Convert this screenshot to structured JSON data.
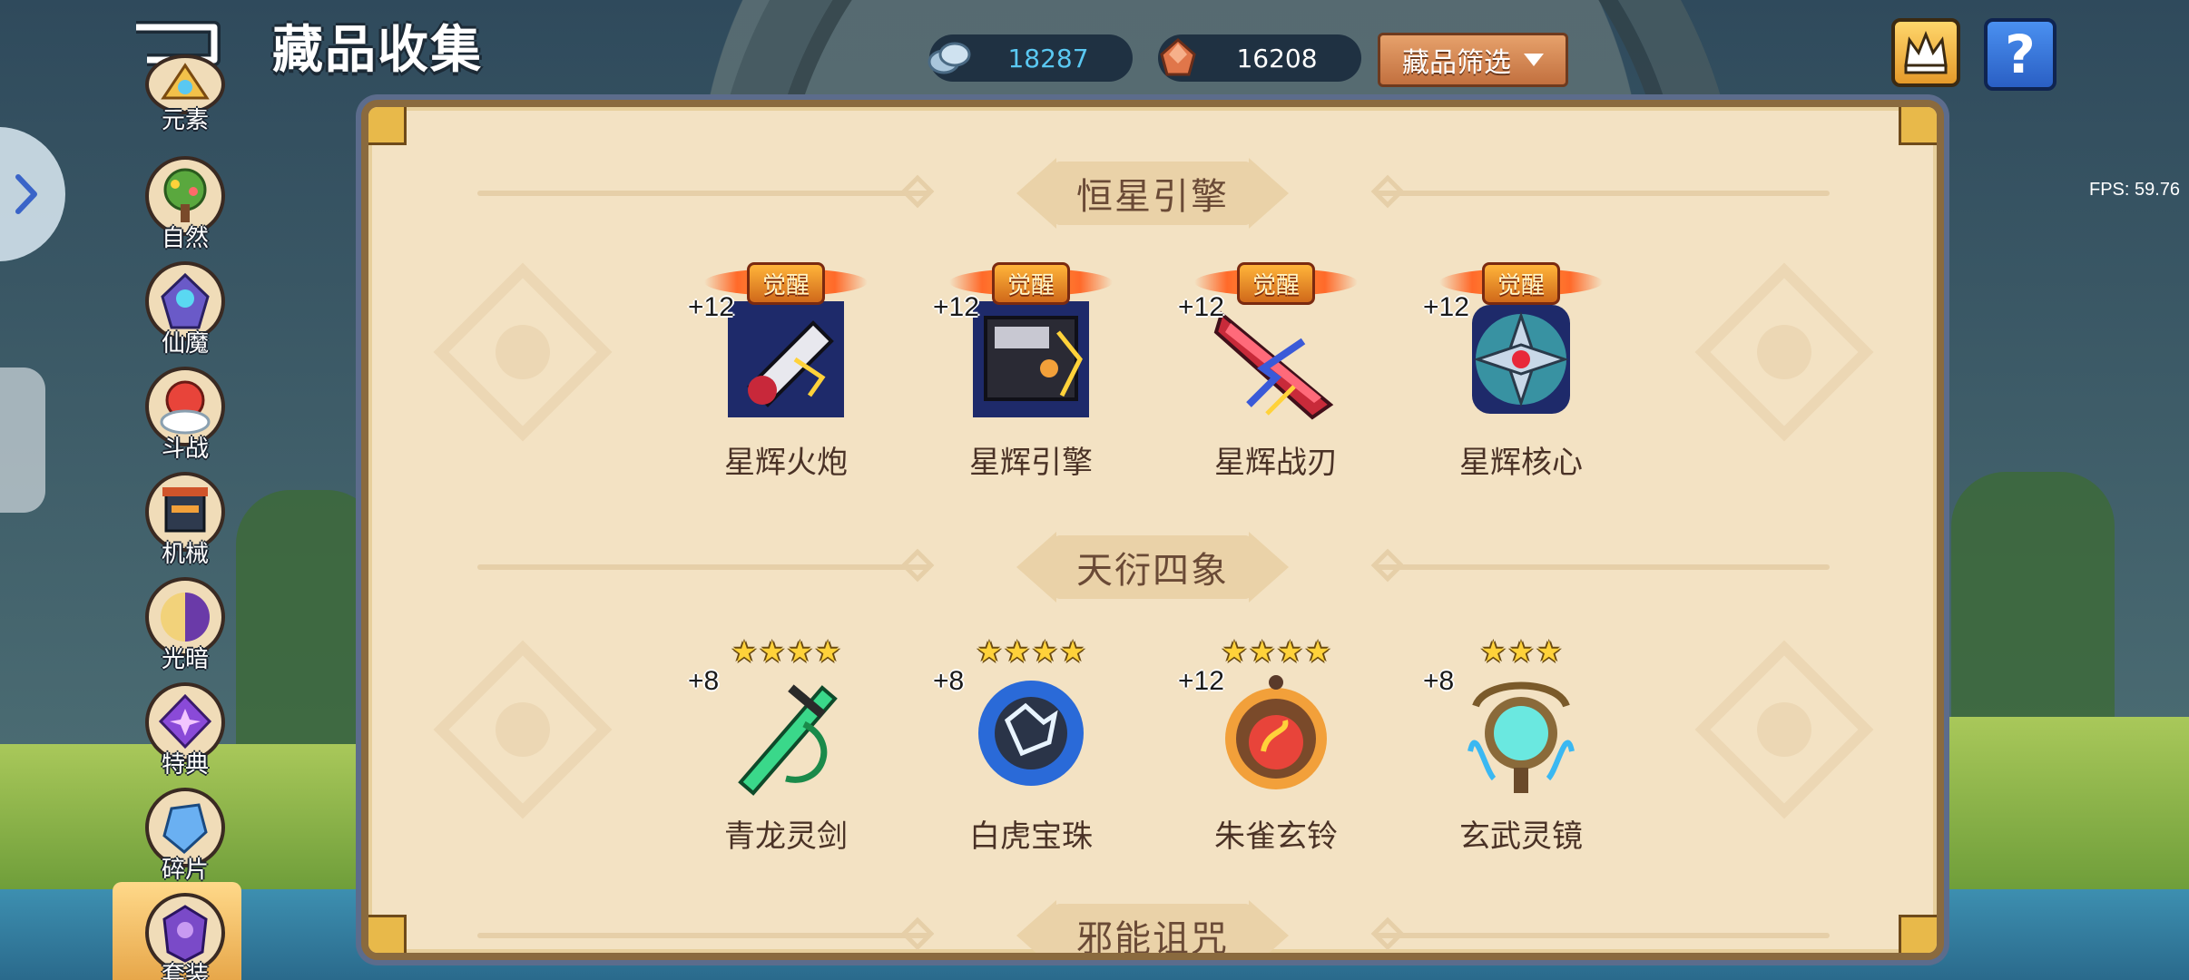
{
  "header": {
    "title": "藏品收集",
    "currencies": [
      {
        "icon": "silver-coin-icon",
        "value": "18287"
      },
      {
        "icon": "ore-crystal-icon",
        "value": "16208"
      }
    ],
    "filter_label": "藏品筛选",
    "fps": "FPS: 59.76"
  },
  "sidebar": {
    "items": [
      {
        "label": "元素"
      },
      {
        "label": "自然"
      },
      {
        "label": "仙魔"
      },
      {
        "label": "斗战"
      },
      {
        "label": "机械"
      },
      {
        "label": "光暗"
      },
      {
        "label": "特典"
      },
      {
        "label": "碎片"
      },
      {
        "label": "套装",
        "active": true
      }
    ]
  },
  "sections": [
    {
      "title": "恒星引擎",
      "items": [
        {
          "name": "星辉火炮",
          "level": "+12",
          "badge": "觉醒",
          "icon": "star-cannon-icon"
        },
        {
          "name": "星辉引擎",
          "level": "+12",
          "badge": "觉醒",
          "icon": "star-engine-icon"
        },
        {
          "name": "星辉战刃",
          "level": "+12",
          "badge": "觉醒",
          "icon": "star-blade-icon"
        },
        {
          "name": "星辉核心",
          "level": "+12",
          "badge": "觉醒",
          "icon": "star-core-icon"
        }
      ]
    },
    {
      "title": "天衍四象",
      "items": [
        {
          "name": "青龙灵剑",
          "level": "+8",
          "stars": 4,
          "icon": "dragon-sword-icon"
        },
        {
          "name": "白虎宝珠",
          "level": "+8",
          "stars": 4,
          "icon": "tiger-orb-icon"
        },
        {
          "name": "朱雀玄铃",
          "level": "+12",
          "stars": 4,
          "icon": "phoenix-bell-icon"
        },
        {
          "name": "玄武灵镜",
          "level": "+8",
          "stars": 3,
          "icon": "tortoise-mirror-icon"
        }
      ]
    },
    {
      "title": "邪能诅咒",
      "items": []
    }
  ],
  "colors": {
    "panel_bg": "#f3e2c3",
    "panel_border": "#8a6a3e",
    "title_text": "#6a4a36",
    "item_name": "#4a3226",
    "currency1_text": "#5ac8f2",
    "filter_button": "#d68a56",
    "help_button": "#3a78e0",
    "awaken_badge": "#e08a2a"
  }
}
